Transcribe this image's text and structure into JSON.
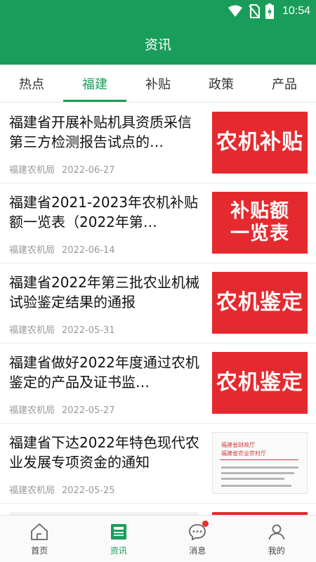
{
  "status": {
    "time": "10:54"
  },
  "header": {
    "title": "资讯"
  },
  "tabs": [
    {
      "label": "热点"
    },
    {
      "label": "福建"
    },
    {
      "label": "补贴"
    },
    {
      "label": "政策"
    },
    {
      "label": "产品"
    }
  ],
  "articles": [
    {
      "title": "福建省开展补贴机具资质采信第三方检测报告试点的…",
      "source": "福建农机局",
      "date": "2022-06-27",
      "thumb": "农机补贴"
    },
    {
      "title": "福建省2021-2023年农机补贴额一览表（2022年第…",
      "source": "福建农机局",
      "date": "2022-06-14",
      "thumb_line1": "补贴额",
      "thumb_line2": "一览表"
    },
    {
      "title": "福建省2022年第三批农业机械试验鉴定结果的通报",
      "source": "福建农机局",
      "date": "2022-05-31",
      "thumb": "农机鉴定"
    },
    {
      "title": "福建省做好2022年度通过农机鉴定的产品及证书监…",
      "source": "福建农机局",
      "date": "2022-05-27",
      "thumb": "农机鉴定"
    },
    {
      "title": "福建省下达2022年特色现代农业发展专项资金的通知",
      "source": "福建农机局",
      "date": "2022-05-25",
      "doc_head1": "福建省财政厅",
      "doc_head2": "福建省农业农村厅"
    }
  ],
  "bottom_nav": [
    {
      "label": "首页",
      "icon": "home-icon"
    },
    {
      "label": "资讯",
      "icon": "news-icon"
    },
    {
      "label": "消息",
      "icon": "message-icon"
    },
    {
      "label": "我的",
      "icon": "profile-icon"
    }
  ],
  "colors": {
    "brand": "#1a9d5a",
    "thumb_red": "#e52a2f",
    "badge": "#e8302a"
  }
}
